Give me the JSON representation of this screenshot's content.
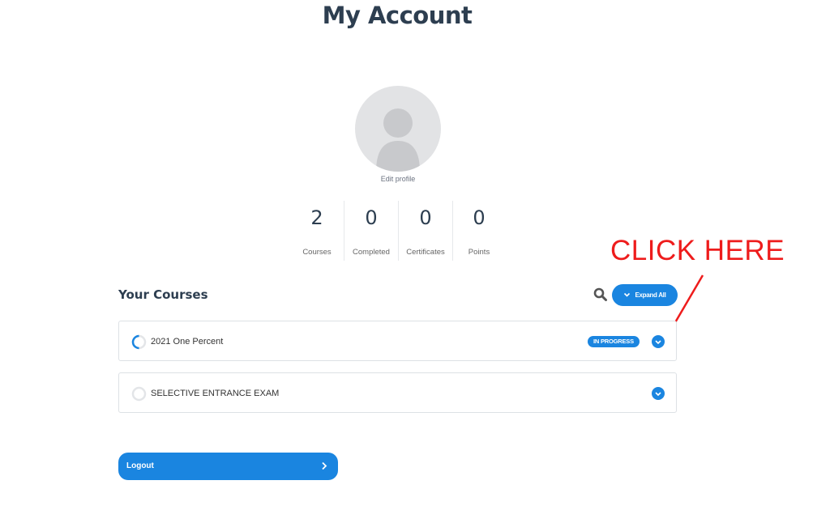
{
  "page": {
    "title": "My Account"
  },
  "profile": {
    "edit_label": "Edit profile"
  },
  "stats": [
    {
      "value": "2",
      "label": "Courses"
    },
    {
      "value": "0",
      "label": "Completed"
    },
    {
      "value": "0",
      "label": "Certificates"
    },
    {
      "value": "0",
      "label": "Points"
    }
  ],
  "annotation": {
    "text": "CLICK HERE",
    "color": "#ee1c1c"
  },
  "courses_section": {
    "title": "Your Courses",
    "search_icon": "search-icon",
    "expand_all_label": "Expand All",
    "items": [
      {
        "name": "2021 One Percent",
        "status": "IN PROGRESS",
        "progress_icon": "partial-progress-ring",
        "toggle_icon": "chevron-down-icon"
      },
      {
        "name": "SELECTIVE ENTRANCE EXAM",
        "status": "",
        "progress_icon": "empty-progress-ring",
        "toggle_icon": "chevron-down-icon"
      }
    ]
  },
  "logout": {
    "label": "Logout",
    "icon": "chevron-right-icon"
  },
  "colors": {
    "accent": "#1a85e0",
    "heading": "#2d3e50",
    "annotation": "#ee1c1c"
  }
}
